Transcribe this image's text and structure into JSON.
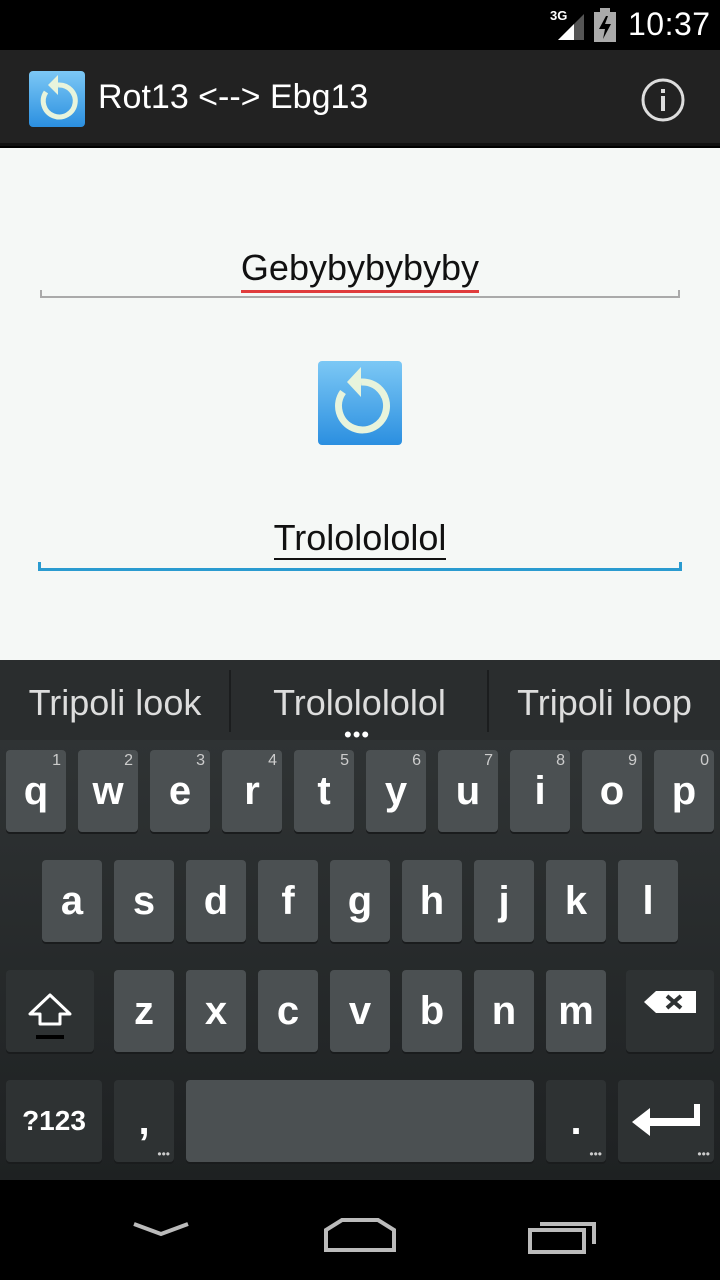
{
  "status_bar": {
    "network": "3G",
    "time": "10:37"
  },
  "action_bar": {
    "title": "Rot13 <--> Ebg13",
    "app_icon": "rotate-icon",
    "info_icon": "info-icon"
  },
  "main": {
    "input_text": "Gebybybybyby",
    "output_text": "Trololololol",
    "rotate_icon": "rotate-icon"
  },
  "suggestions": [
    "Tripoli look",
    "Trololololol",
    "Tripoli loop"
  ],
  "suggestions_more": "•••",
  "keyboard": {
    "row1": [
      {
        "ch": "q",
        "hint": "1"
      },
      {
        "ch": "w",
        "hint": "2"
      },
      {
        "ch": "e",
        "hint": "3"
      },
      {
        "ch": "r",
        "hint": "4"
      },
      {
        "ch": "t",
        "hint": "5"
      },
      {
        "ch": "y",
        "hint": "6"
      },
      {
        "ch": "u",
        "hint": "7"
      },
      {
        "ch": "i",
        "hint": "8"
      },
      {
        "ch": "o",
        "hint": "9"
      },
      {
        "ch": "p",
        "hint": "0"
      }
    ],
    "row2": [
      "a",
      "s",
      "d",
      "f",
      "g",
      "h",
      "j",
      "k",
      "l"
    ],
    "row3": [
      "z",
      "x",
      "c",
      "v",
      "b",
      "n",
      "m"
    ],
    "symbols_label": "?123",
    "comma_label": ",",
    "period_label": ".",
    "shift_icon": "shift-icon",
    "backspace_icon": "backspace-icon",
    "enter_icon": "enter-icon"
  },
  "nav_bar": {
    "back_icon": "back-chevron-icon",
    "home_icon": "home-icon",
    "recents_icon": "recents-icon"
  },
  "colors": {
    "accent": "#2a9bd0",
    "spellcheck": "#e03c3c",
    "action_bar": "#222222"
  }
}
